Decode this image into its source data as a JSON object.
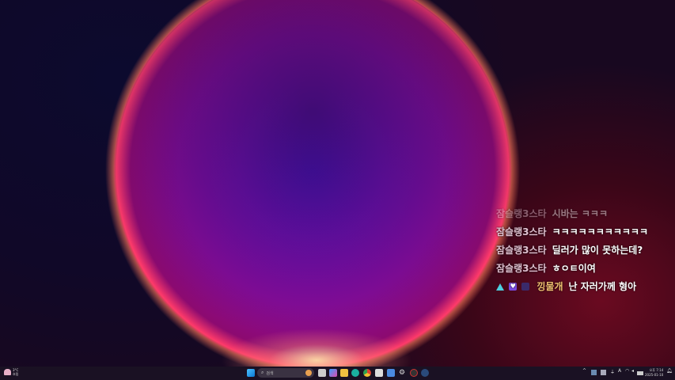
{
  "chat": [
    {
      "nick": "잠슬랭3스타",
      "text": "시바는 ㅋㅋㅋ",
      "faded": true
    },
    {
      "nick": "잠슬랭3스타",
      "text": "ㅋㅋㅋㅋㅋㅋㅋㅋㅋㅋㅋ"
    },
    {
      "nick": "잠슬랭3스타",
      "text": "딜러가 많이 못하는데?"
    },
    {
      "nick": "잠슬랭3스타",
      "text": "ㅎㅇㅌ이여"
    },
    {
      "nick": "낑물개",
      "text": "난 자러가께 형아",
      "badges": [
        "triangle-badge",
        "heart-badge",
        "tier-badge"
      ]
    }
  ],
  "taskbar": {
    "weather": {
      "temp": "3°C",
      "condition": "흐림"
    },
    "search_placeholder": "검색",
    "clock": {
      "time": "오후 7:14",
      "date": "2025-01-10"
    },
    "language": "A"
  }
}
